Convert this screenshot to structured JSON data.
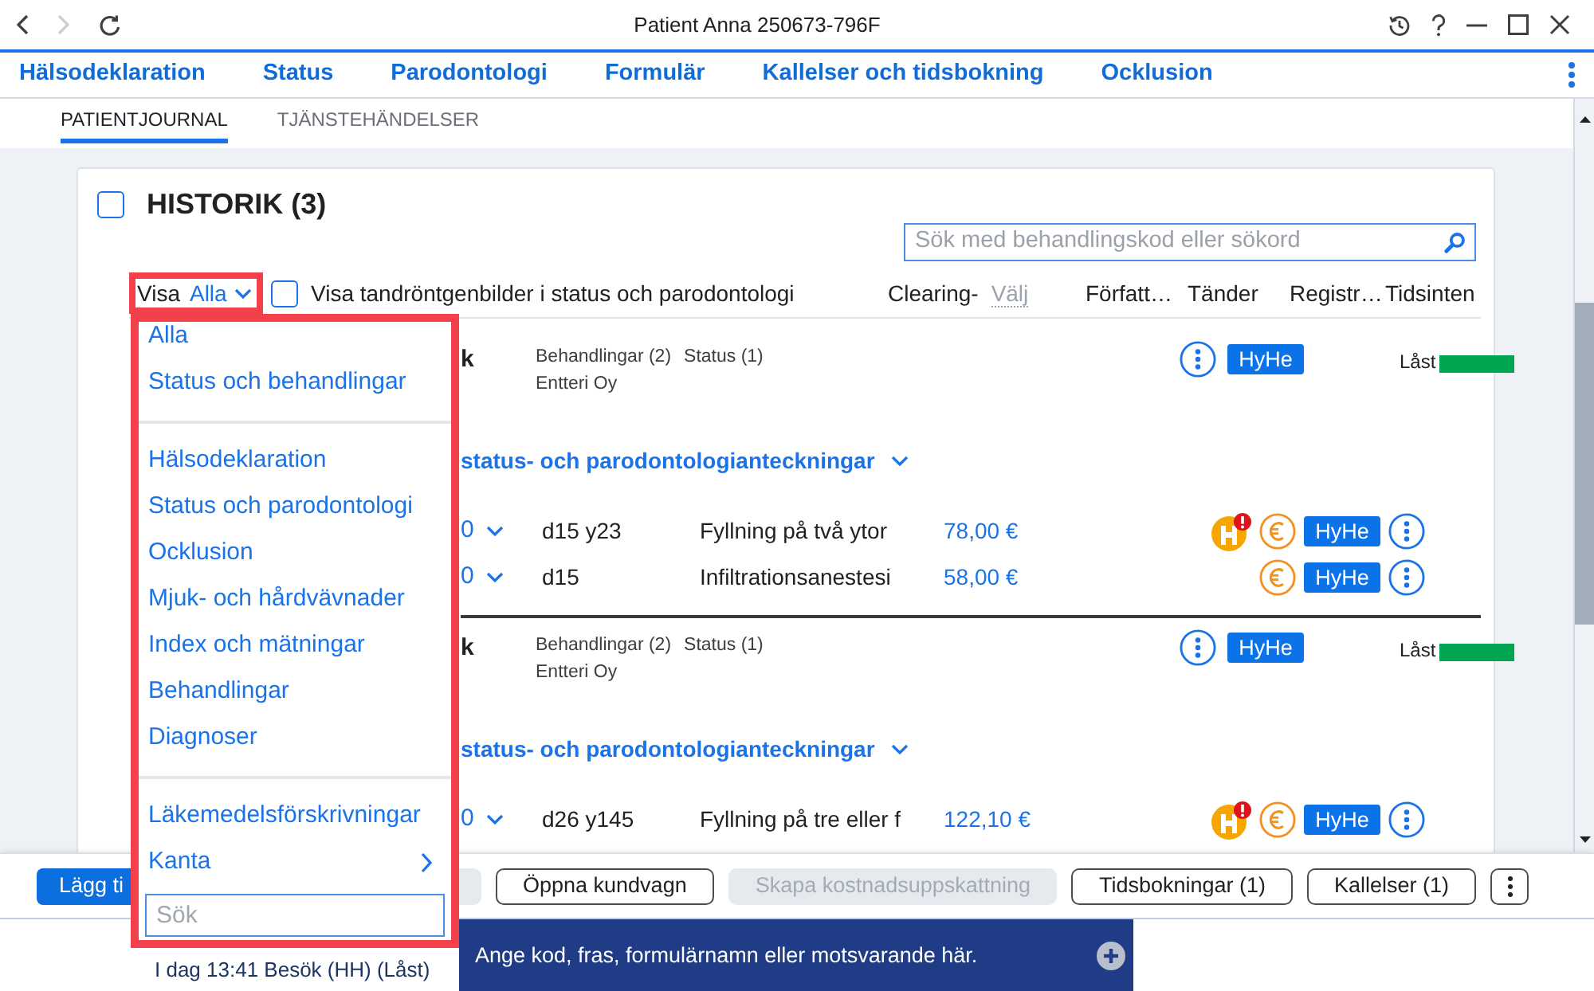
{
  "window": {
    "title": "Patient Anna 250673-796F",
    "nav_buttons": [
      {
        "kind": "back",
        "disabled": false
      },
      {
        "kind": "forward",
        "disabled": true
      },
      {
        "kind": "refresh",
        "disabled": false
      }
    ]
  },
  "main_tabs": [
    "Hälsodeklaration",
    "Status",
    "Parodontologi",
    "Formulär",
    "Kallelser och tidsbokning",
    "Ocklusion"
  ],
  "sub_tabs": [
    {
      "label": "PATIENTJOURNAL",
      "selected": true
    },
    {
      "label": "TJÄNSTEHÄNDELSER",
      "selected": false
    }
  ],
  "history": {
    "title": "HISTORIK (3)",
    "checked": false,
    "search": {
      "placeholder": "Sök med behandlingskod eller sökord"
    },
    "filter": {
      "label": "Visa",
      "value": "Alla",
      "highlighted": true
    },
    "xray_toggle": {
      "label": "Visa tandröntgenbilder i status och parodontologi",
      "checked": false
    },
    "columns": [
      {
        "label": "Clearing-",
        "value": "Välj"
      },
      {
        "label": "Författ…"
      },
      {
        "label": "Tänder"
      },
      {
        "label": "Registr…"
      },
      {
        "label": "Tidsinten"
      }
    ],
    "visits": [
      {
        "title": "k",
        "counts": [
          "Behandlingar (2)",
          "Status (1)"
        ],
        "clinic": "Entteri Oy",
        "author": "HyHe",
        "status": "Låst",
        "color": "#00a651",
        "notes_link": "status- och parodontologianteckningar",
        "treatments": [
          {
            "code": "0",
            "teeth": "d15 y23",
            "description": "Fyllning på två ytor",
            "price": "78,00 €",
            "warning": true,
            "author": "HyHe"
          },
          {
            "code": "0",
            "teeth": "d15",
            "description": "Infiltrationsanestesi",
            "price": "58,00 €",
            "warning": false,
            "author": "HyHe"
          }
        ]
      },
      {
        "title": "k",
        "counts": [
          "Behandlingar (2)",
          "Status (1)"
        ],
        "clinic": "Entteri Oy",
        "author": "HyHe",
        "status": "Låst",
        "color": "#00a651",
        "notes_link": "status- och parodontologianteckningar",
        "treatments": [
          {
            "code": "0",
            "teeth": "d26 y145",
            "description": "Fyllning på tre eller f",
            "price": "122,10 €",
            "warning": true,
            "author": "HyHe"
          }
        ]
      }
    ]
  },
  "filter_menu": {
    "highlighted": true,
    "groups": [
      [
        {
          "label": "Alla",
          "submenu": false
        },
        {
          "label": "Status och behandlingar",
          "submenu": false
        }
      ],
      [
        {
          "label": "Hälsodeklaration",
          "submenu": false
        },
        {
          "label": "Status och parodontologi",
          "submenu": false
        },
        {
          "label": "Ocklusion",
          "submenu": false
        },
        {
          "label": "Mjuk- och hårdvävnader",
          "submenu": false
        },
        {
          "label": "Index och mätningar",
          "submenu": false
        },
        {
          "label": "Behandlingar",
          "submenu": false
        },
        {
          "label": "Diagnoser",
          "submenu": false
        }
      ],
      [
        {
          "label": "Läkemedelsförskrivningar",
          "submenu": false
        },
        {
          "label": "Kanta",
          "submenu": true
        }
      ]
    ],
    "search": {
      "placeholder": "Sök"
    }
  },
  "toolbar": {
    "buttons": [
      {
        "kind": "primary",
        "label": "Lägg ti",
        "disabled": false
      },
      {
        "kind": "outline",
        "disabled": true
      },
      {
        "kind": "outline",
        "label": "Öppna kundvagn",
        "disabled": false
      },
      {
        "kind": "outline",
        "label": "Skapa kostnadsuppskattning",
        "disabled": true
      },
      {
        "kind": "outline",
        "label": "Tidsbokningar (1)",
        "disabled": false
      },
      {
        "kind": "outline",
        "label": "Kallelser (1)",
        "disabled": false
      },
      {
        "kind": "more",
        "disabled": false
      }
    ]
  },
  "status_line": "I dag 13:41 Besök (HH) (Låst)",
  "command_bar": {
    "placeholder": "Ange kod, fras, formulärnamn eller motsvarande här."
  }
}
